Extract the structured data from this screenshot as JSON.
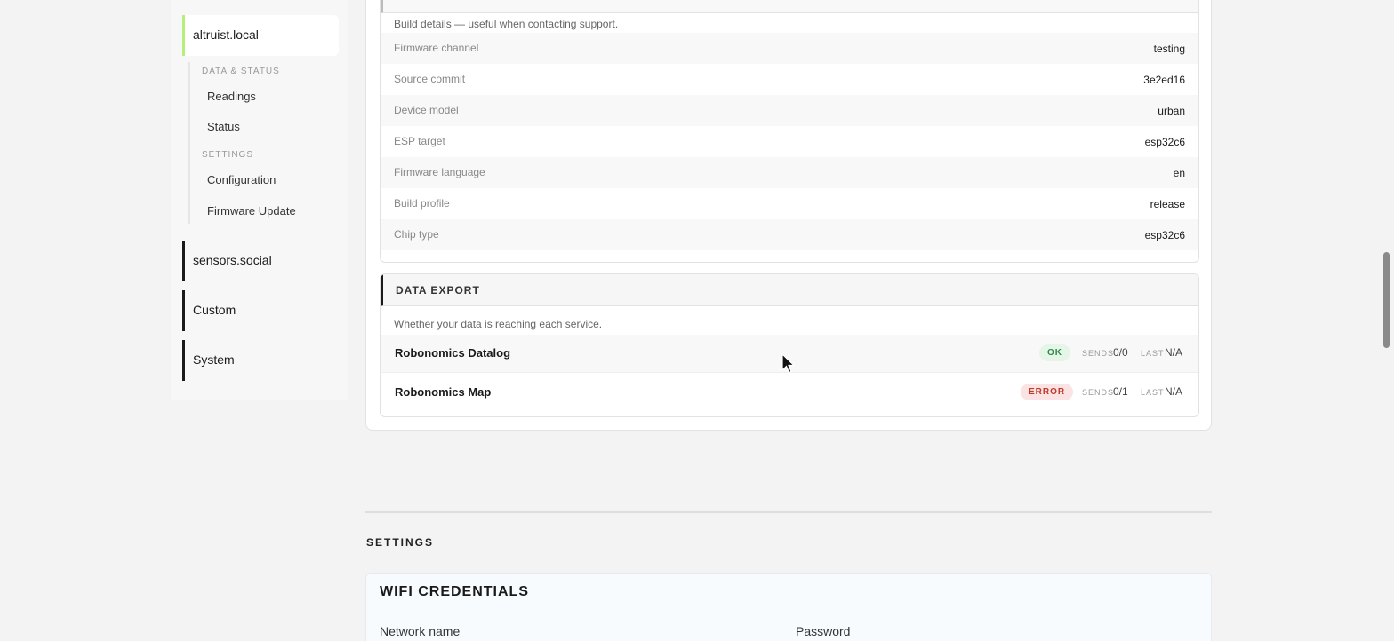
{
  "sidebar": {
    "active_group": "altruist.local",
    "sections": [
      {
        "label": "DATA & STATUS",
        "items": [
          "Readings",
          "Status"
        ]
      },
      {
        "label": "SETTINGS",
        "items": [
          "Configuration",
          "Firmware Update"
        ]
      }
    ],
    "groups": [
      "sensors.social",
      "Custom",
      "System"
    ]
  },
  "build": {
    "description": "Build details — useful when contacting support.",
    "rows": [
      {
        "key": "Firmware channel",
        "value": "testing"
      },
      {
        "key": "Source commit",
        "value": "3e2ed16"
      },
      {
        "key": "Device model",
        "value": "urban"
      },
      {
        "key": "ESP target",
        "value": "esp32c6"
      },
      {
        "key": "Firmware language",
        "value": "en"
      },
      {
        "key": "Build profile",
        "value": "release"
      },
      {
        "key": "Chip type",
        "value": "esp32c6"
      }
    ]
  },
  "export": {
    "title": "DATA EXPORT",
    "description": "Whether your data is reaching each service.",
    "sends_label": "SENDS",
    "last_label": "LAST",
    "services": [
      {
        "name": "Robonomics Datalog",
        "status": "OK",
        "sends": "0/0",
        "last": "N/A"
      },
      {
        "name": "Robonomics Map",
        "status": "ERROR",
        "sends": "0/1",
        "last": "N/A"
      }
    ]
  },
  "settings": {
    "title": "SETTINGS",
    "wifi": {
      "title": "WIFI CREDENTIALS",
      "network_label": "Network name",
      "password_label": "Password"
    }
  },
  "colors": {
    "active_accent": "#b6f07a",
    "ok_bg": "#e5f5e8",
    "ok_text": "#2e8a45",
    "error_bg": "#fbe3e3",
    "error_text": "#c0392b"
  }
}
